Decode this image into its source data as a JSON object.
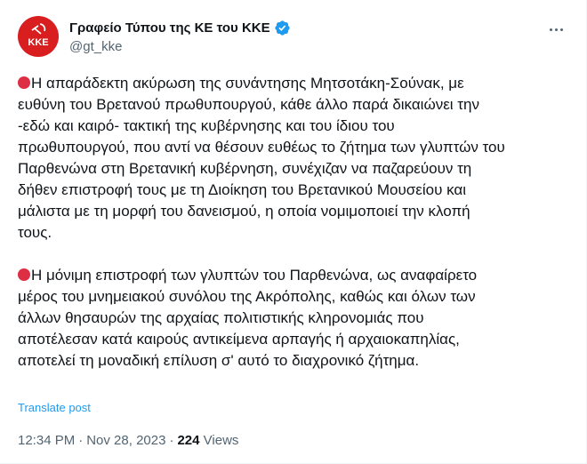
{
  "author": {
    "display_name": "Γραφείο Τύπου της ΚΕ του ΚΚΕ",
    "handle": "@gt_kke",
    "avatar_text": "ΚΚΕ",
    "avatar_color": "#d81e1e",
    "verified": true,
    "verified_color": "#1d9bf0"
  },
  "more_icon": "more-horizontal-icon",
  "paragraphs": [
    {
      "bullet": "red-circle-emoji",
      "text": "Η απαράδεκτη ακύρωση της συνάντησης Μητσοτάκη-Σούνακ, με\nευθύνη του Βρετανού πρωθυπουργού, κάθε άλλο παρά δικαιώνει την\n-εδώ και καιρό- τακτική της κυβέρνησης και του ίδιου του\nπρωθυπουργού, που αντί να θέσουν ευθέως το ζήτημα των γλυπτών του\nΠαρθενώνα στη Βρετανική κυβέρνηση, συνέχιζαν να παζαρεύουν τη\nδήθεν επιστροφή τους με τη Διοίκηση του Βρετανικού Μουσείου και\nμάλιστα με τη μορφή του δανεισμού, η οποία νομιμοποιεί την κλοπή\nτους."
    },
    {
      "bullet": "red-circle-emoji",
      "text": "Η μόνιμη επιστροφή των γλυπτών του Παρθενώνα, ως αναφαίρετο\nμέρος του μνημειακού συνόλου της Ακρόπολης, καθώς και όλων των\nάλλων θησαυρών της αρχαίας πολιτιστικής κληρονομιάς που\nαποτέλεσαν κατά καιρούς αντικείμενα αρπαγής ή αρχαιοκαπηλίας,\nαποτελεί τη μοναδική επίλυση σ' αυτό το διαχρονικό ζήτημα."
    }
  ],
  "translate_label": "Translate post",
  "meta": {
    "time": "12:34 PM",
    "separator": "·",
    "date": "Nov 28, 2023",
    "views_count": "224",
    "views_label": "Views"
  },
  "colors": {
    "text": "#0f1419",
    "secondary": "#536471",
    "link": "#1d9bf0",
    "red_dot": "#dd2e44"
  }
}
